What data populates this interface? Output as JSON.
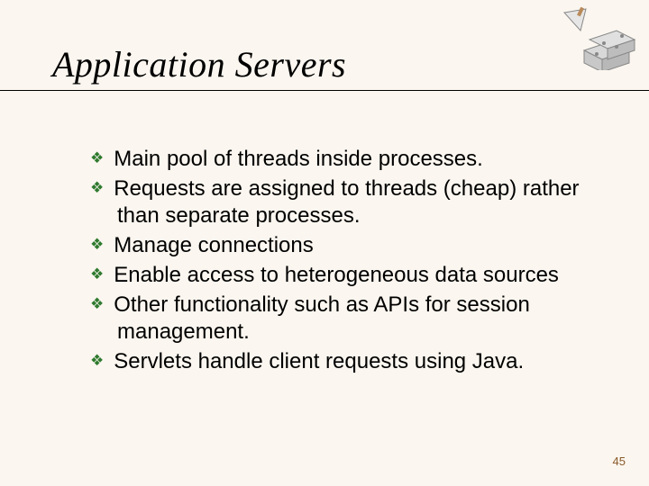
{
  "title": "Application Servers",
  "bullets": [
    "Main pool of threads inside processes.",
    "Requests are assigned to threads (cheap) rather than separate processes.",
    "Manage connections",
    "Enable access to heterogeneous data sources",
    "Other functionality such as APIs for session management.",
    "Servlets handle client requests using Java."
  ],
  "page_number": "45"
}
